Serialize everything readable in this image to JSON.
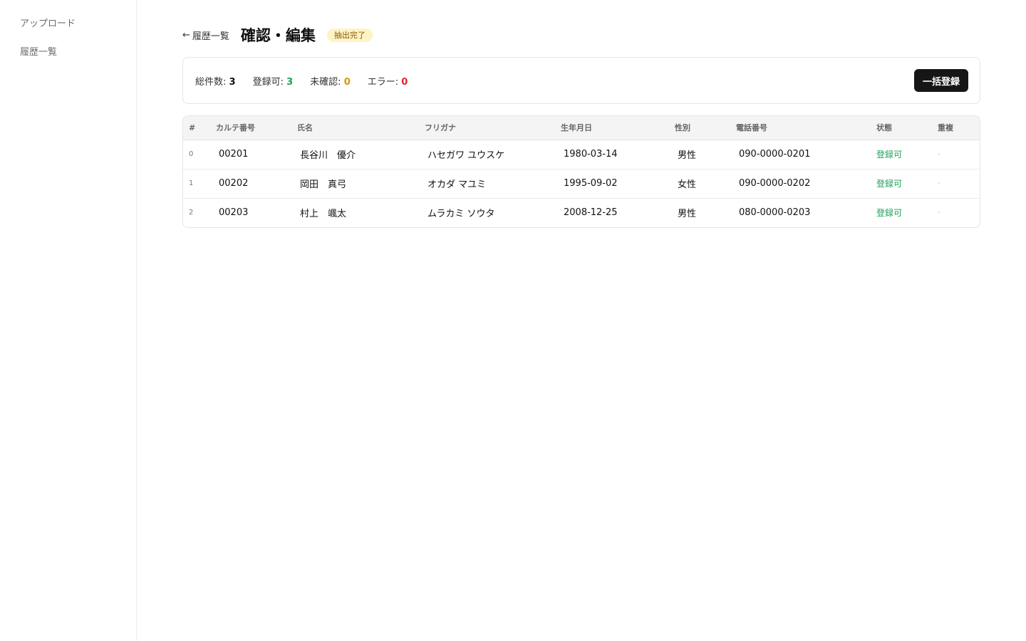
{
  "sidebar": {
    "items": [
      {
        "label": "アップロード"
      },
      {
        "label": "履歴一覧"
      }
    ]
  },
  "header": {
    "back_arrow": "←",
    "back_label": "履歴一覧",
    "title": "確認・編集",
    "status_badge": "抽出完了"
  },
  "summary": {
    "total_label": "総件数:",
    "total_value": "3",
    "ok_label": "登録可:",
    "ok_value": "3",
    "unconfirmed_label": "未確認:",
    "unconfirmed_value": "0",
    "error_label": "エラー:",
    "error_value": "0",
    "bulk_button": "一括登録"
  },
  "table": {
    "columns": [
      "#",
      "カルテ番号",
      "氏名",
      "フリガナ",
      "生年月日",
      "性別",
      "電話番号",
      "状態",
      "重複"
    ],
    "rows": [
      {
        "idx": "0",
        "karte": "00201",
        "name": "長谷川　優介",
        "kana": "ハセガワ ユウスケ",
        "dob": "1980-03-14",
        "sex": "男性",
        "phone": "090-0000-0201",
        "status": "登録可",
        "dup": "-"
      },
      {
        "idx": "1",
        "karte": "00202",
        "name": "岡田　真弓",
        "kana": "オカダ マユミ",
        "dob": "1995-09-02",
        "sex": "女性",
        "phone": "090-0000-0202",
        "status": "登録可",
        "dup": "-"
      },
      {
        "idx": "2",
        "karte": "00203",
        "name": "村上　颯太",
        "kana": "ムラカミ ソウタ",
        "dob": "2008-12-25",
        "sex": "男性",
        "phone": "080-0000-0203",
        "status": "登録可",
        "dup": "-"
      }
    ]
  },
  "colors": {
    "ok": "#1f9d55",
    "unconfirmed": "#d4940b",
    "error": "#e0242a",
    "badge_bg": "#fdf3c4",
    "button_bg": "#161616"
  }
}
